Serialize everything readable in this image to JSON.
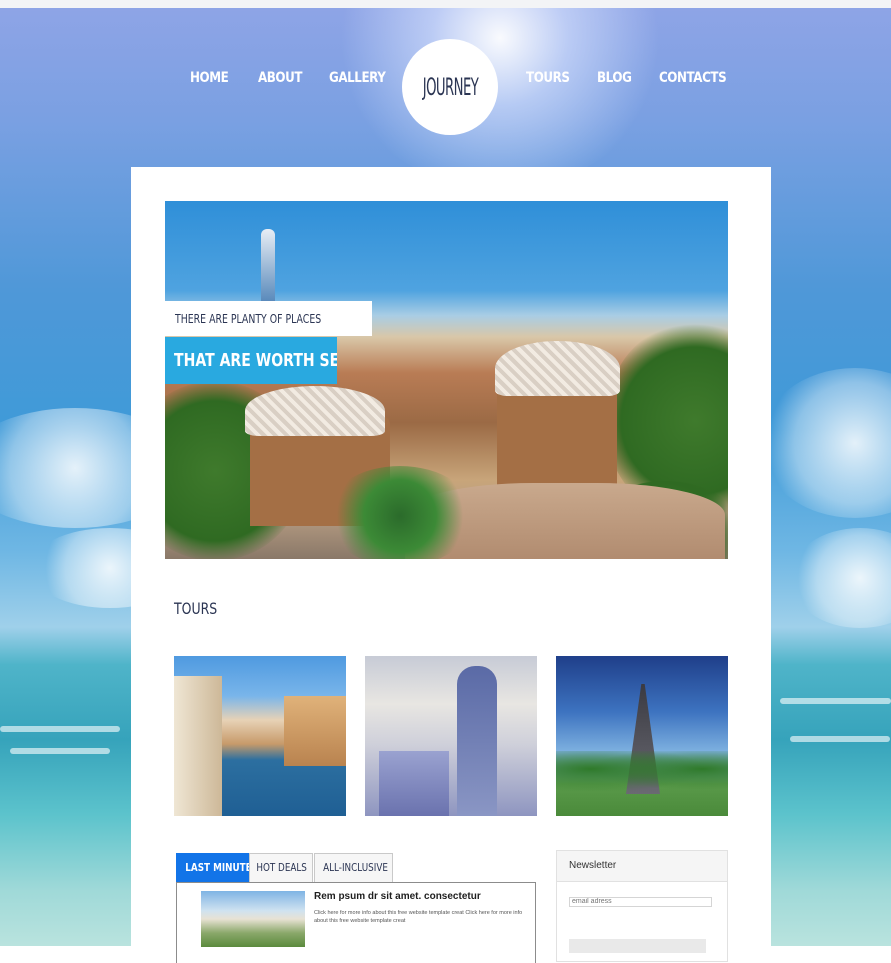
{
  "nav": {
    "items": [
      "HOME",
      "ABOUT",
      "GALLERY",
      "TOURS",
      "BLOG",
      "CONTACTS"
    ],
    "logo_text": "JOURNEY"
  },
  "hero": {
    "tagline_small": "THERE ARE PLANTY OF PLACES",
    "tagline_big": "THAT ARE WORTH SEEING"
  },
  "tours": {
    "title": "TOURS",
    "images": [
      "venice-canal-photo",
      "statue-of-liberty-photo",
      "eiffel-tower-photo"
    ]
  },
  "tabs": {
    "items": [
      "LAST MINUTE",
      "HOT DEALS",
      "ALL-INCLUSIVE"
    ],
    "active": "LAST MINUTE",
    "article": {
      "title": "Rem psum dr sit amet. consectetur",
      "text": "Click here for more info about this free website template creat Click here for more info about this free website template creat"
    }
  },
  "newsletter": {
    "title": "Newsletter",
    "input_placeholder": "email adress"
  },
  "colors": {
    "accent_blue": "#29a9e0",
    "tab_active": "#1274e8",
    "text_dark": "#2b3553"
  }
}
